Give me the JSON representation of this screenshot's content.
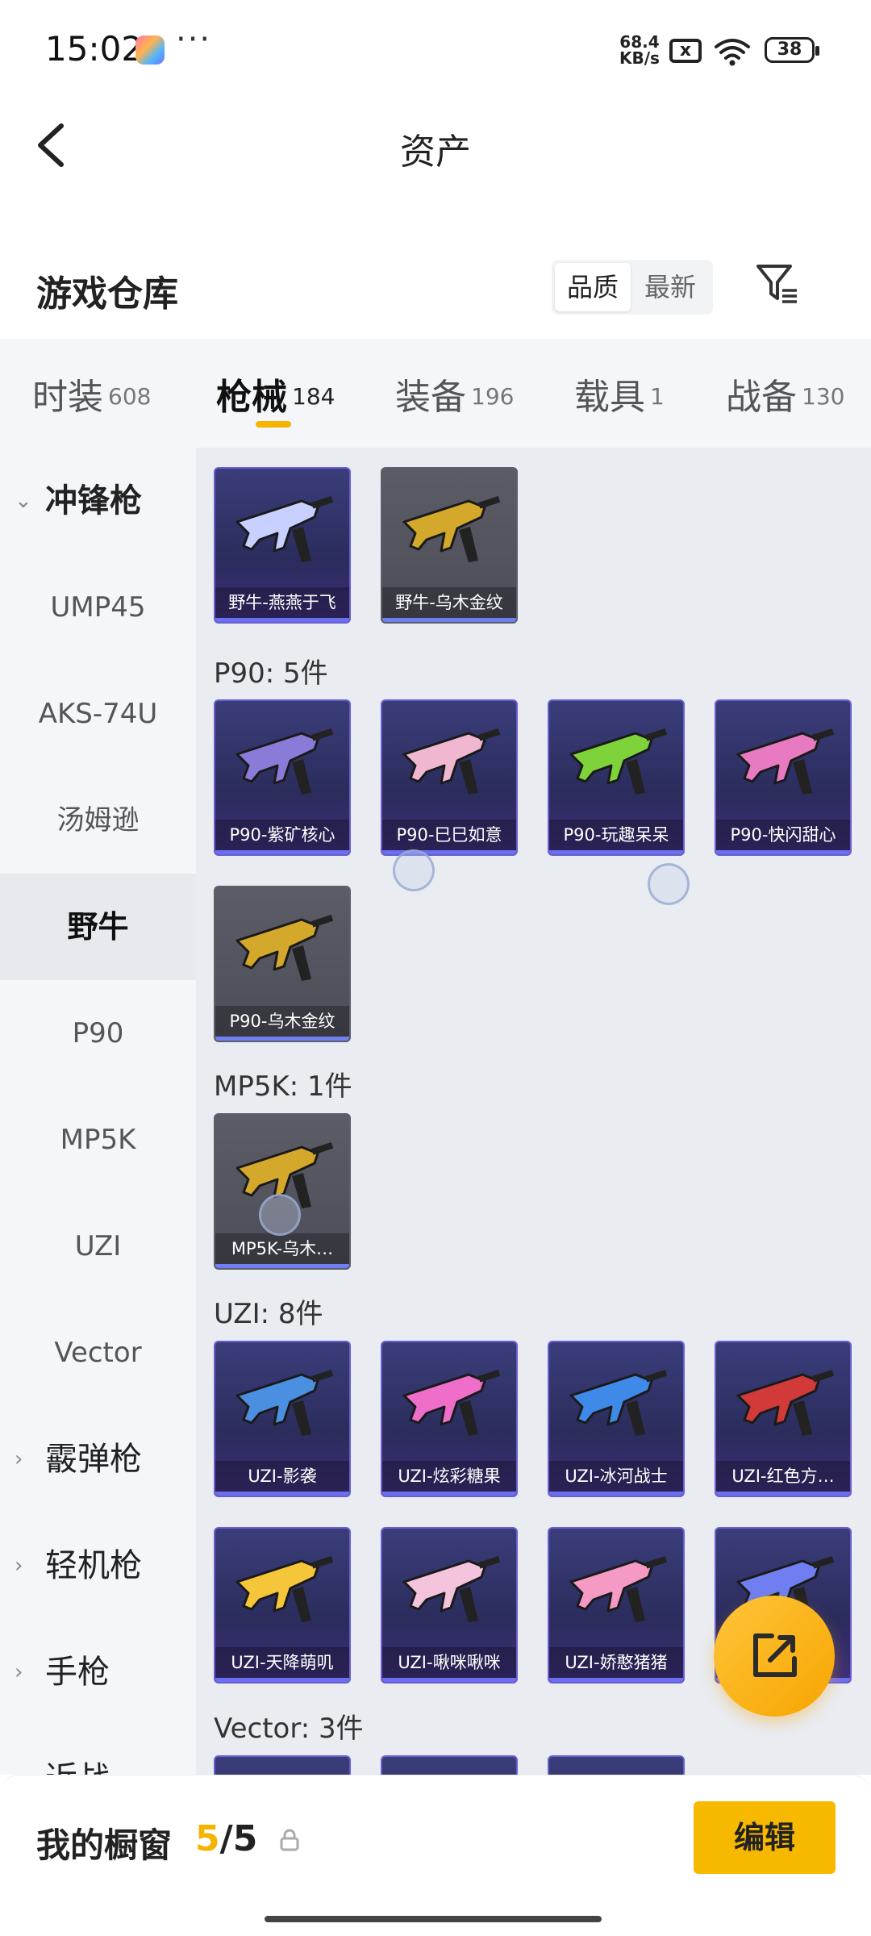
{
  "status_bar": {
    "time": "15:02",
    "more": "···",
    "net_speed_value": "68.4",
    "net_speed_unit": "KB/s",
    "sim_icon": "x",
    "battery": "38"
  },
  "header": {
    "title": "资产"
  },
  "warehouse": {
    "title": "游戏仓库",
    "sort_options": [
      "品质",
      "最新"
    ],
    "active_sort": "品质"
  },
  "tabs": [
    {
      "label": "时装",
      "count": "608"
    },
    {
      "label": "枪械",
      "count": "184",
      "active": true
    },
    {
      "label": "装备",
      "count": "196"
    },
    {
      "label": "载具",
      "count": "1"
    },
    {
      "label": "战备",
      "count": "130"
    }
  ],
  "sidebar": {
    "items": [
      {
        "label": "冲锋枪",
        "type": "category",
        "expanded": true
      },
      {
        "label": "UMP45"
      },
      {
        "label": "AKS-74U"
      },
      {
        "label": "汤姆逊"
      },
      {
        "label": "野牛",
        "selected": true
      },
      {
        "label": "P90"
      },
      {
        "label": "MP5K"
      },
      {
        "label": "UZI"
      },
      {
        "label": "Vector"
      },
      {
        "label": "霰弹枪",
        "type": "category"
      },
      {
        "label": "轻机枪",
        "type": "category"
      },
      {
        "label": "手枪",
        "type": "category"
      },
      {
        "label": "近战",
        "type": "category"
      }
    ]
  },
  "groups": [
    {
      "title": "",
      "items": [
        {
          "name": "野牛-燕燕于飞",
          "color": "#c8d0ff"
        },
        {
          "name": "野牛-乌木金纹",
          "color": "#d4a82a"
        }
      ]
    },
    {
      "title": "P90: 5件",
      "items": [
        {
          "name": "P90-紫矿核心",
          "color": "#8a7bd8"
        },
        {
          "name": "P90-巳巳如意",
          "color": "#f0b8d0"
        },
        {
          "name": "P90-玩趣呆呆",
          "color": "#7ed33a"
        },
        {
          "name": "P90-快闪甜心",
          "color": "#e77ac0"
        },
        {
          "name": "P90-乌木金纹",
          "color": "#d4a82a"
        }
      ]
    },
    {
      "title": "MP5K: 1件",
      "items": [
        {
          "name": "MP5K-乌木…",
          "color": "#d4a82a"
        }
      ]
    },
    {
      "title": "UZI: 8件",
      "items": [
        {
          "name": "UZI-影袭",
          "color": "#4a8fe0"
        },
        {
          "name": "UZI-炫彩糖果",
          "color": "#ee6ec9"
        },
        {
          "name": "UZI-冰河战士",
          "color": "#3f8ae8"
        },
        {
          "name": "UZI-红色方…",
          "color": "#d23a3a"
        },
        {
          "name": "UZI-天降萌叽",
          "color": "#f5c53a"
        },
        {
          "name": "UZI-啾咪啾咪",
          "color": "#f3c4dc"
        },
        {
          "name": "UZI-娇憨猪猪",
          "color": "#f49ac4"
        },
        {
          "name": "",
          "color": "#6f7ef0"
        }
      ]
    },
    {
      "title": "Vector: 3件",
      "items": [
        {
          "name": "",
          "color": "#6a5fd0"
        },
        {
          "name": "",
          "color": "#6a5fd0"
        },
        {
          "name": "",
          "color": "#6a5fd0"
        }
      ]
    }
  ],
  "showcase": {
    "label": "我的橱窗",
    "current": "5",
    "total": "/5",
    "edit_label": "编辑"
  },
  "colors": {
    "accent": "#f5b400",
    "card_border": "#6a5fd0"
  },
  "icons": [
    "back-icon",
    "filter-icon",
    "chevron-down-icon",
    "chevron-right-icon",
    "lock-icon",
    "share-icon",
    "wifi-icon",
    "battery-icon"
  ]
}
